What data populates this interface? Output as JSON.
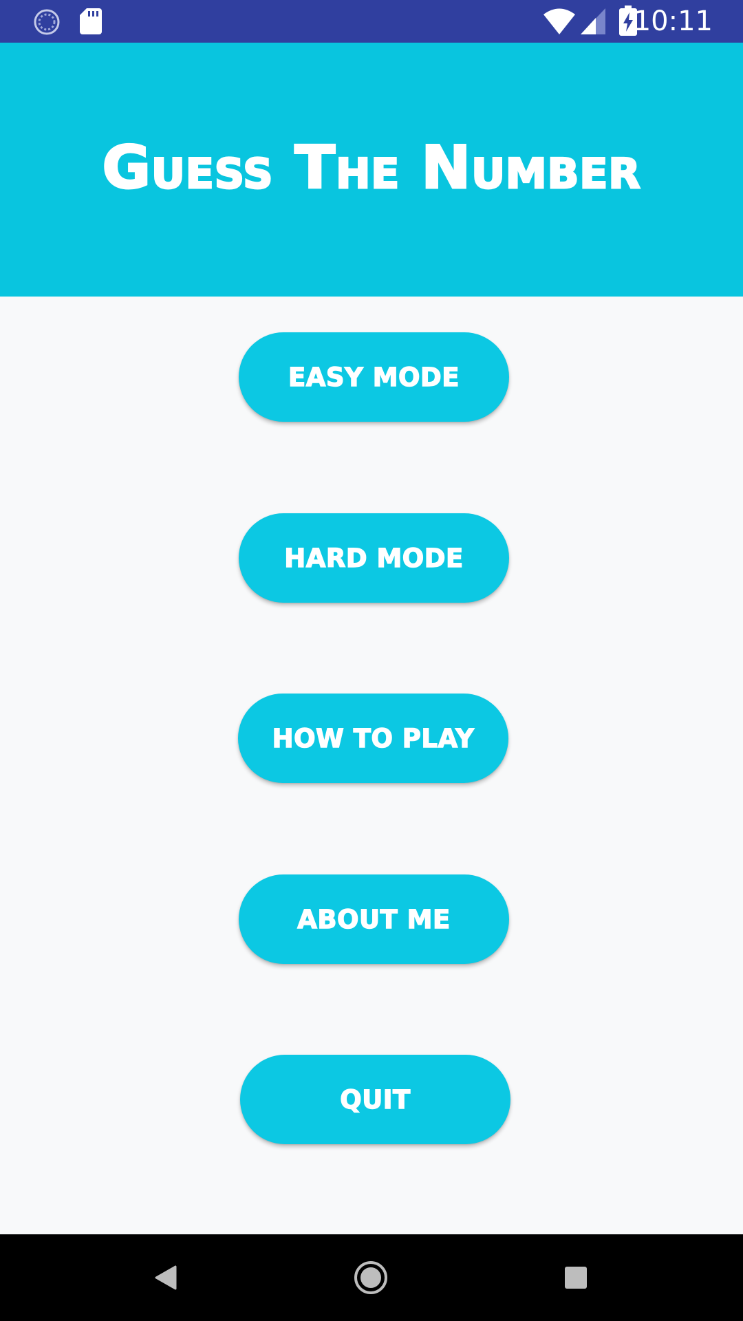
{
  "status_bar": {
    "time": "10:11",
    "icons": [
      "sync-icon",
      "sd-card-icon",
      "wifi-icon",
      "signal-icon",
      "battery-charging-icon"
    ]
  },
  "header": {
    "title": "Guess The Number"
  },
  "menu": {
    "easy_label": "EASY MODE",
    "hard_label": "HARD MODE",
    "how_label": "HOW TO PLAY",
    "about_label": "ABOUT ME",
    "quit_label": "QUIT"
  },
  "nav_bar": {
    "icons": [
      "back-icon",
      "home-icon",
      "recents-icon"
    ]
  },
  "colors": {
    "status_bar": "#303f9f",
    "header": "#09c5df",
    "button": "#0cc8e3",
    "background": "#f8f9fa"
  }
}
